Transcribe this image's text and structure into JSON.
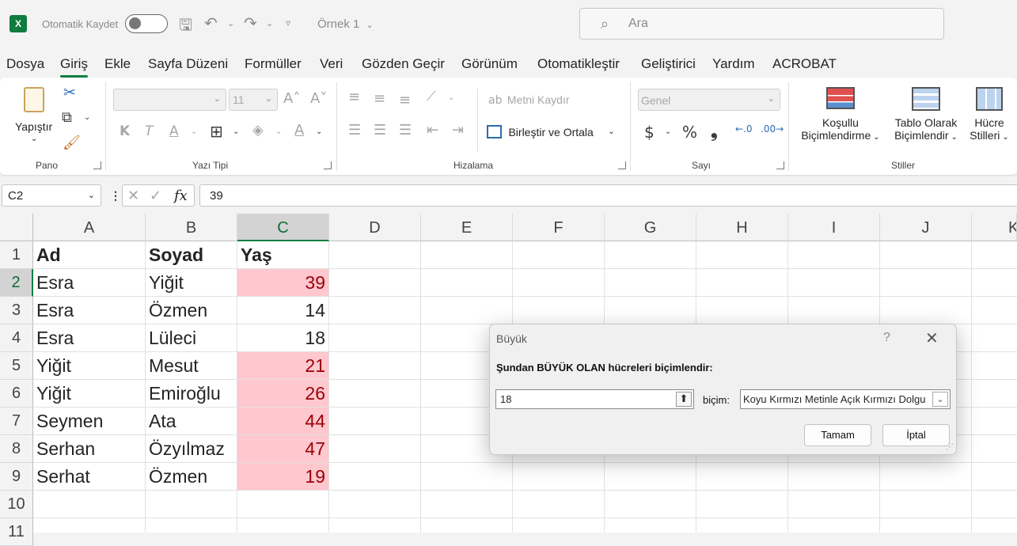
{
  "titlebar": {
    "autosave_label": "Otomatik Kaydet",
    "filename": "Örnek 1",
    "search_placeholder": "Ara"
  },
  "menu": [
    "Dosya",
    "Giriş",
    "Ekle",
    "Sayfa Düzeni",
    "Formüller",
    "Veri",
    "Gözden Geçir",
    "Görünüm",
    "Otomatikleştir",
    "Geliştirici",
    "Yardım",
    "ACROBAT"
  ],
  "menu_active": "Giriş",
  "ribbon": {
    "pano": {
      "label": "Pano",
      "paste": "Yapıştır"
    },
    "yazi_tipi": {
      "label": "Yazı Tipi",
      "font_size": "11",
      "bold": "K",
      "italic": "T",
      "underline": "A"
    },
    "hizalama": {
      "label": "Hizalama",
      "wrap": "Metni Kaydır",
      "merge": "Birleştir ve Ortala"
    },
    "sayi": {
      "label": "Sayı",
      "format": "Genel",
      "currency": "$",
      "percent": "%",
      "comma": "❟"
    },
    "stiller": {
      "label": "Stiller",
      "cond_l1": "Koşullu",
      "cond_l2": "Biçimlendirme",
      "table_l1": "Tablo Olarak",
      "table_l2": "Biçimlendir",
      "cell_l1": "Hücre",
      "cell_l2": "Stilleri"
    }
  },
  "formula_bar": {
    "name_box": "C2",
    "formula": "39"
  },
  "columns": [
    "A",
    "B",
    "C",
    "D",
    "E",
    "F",
    "G",
    "H",
    "I",
    "J",
    "K"
  ],
  "rows": [
    "1",
    "2",
    "3",
    "4",
    "5",
    "6",
    "7",
    "8",
    "9",
    "10",
    "11"
  ],
  "table": {
    "headers": [
      "Ad",
      "Soyad",
      "Yaş"
    ],
    "data": [
      [
        "Esra",
        "Yiğit",
        "39"
      ],
      [
        "Esra",
        "Özmen",
        "14"
      ],
      [
        "Esra",
        "Lüleci",
        "18"
      ],
      [
        "Yiğit",
        "Mesut",
        "21"
      ],
      [
        "Yiğit",
        "Emiroğlu",
        "26"
      ],
      [
        "Seymen",
        "Ata",
        "44"
      ],
      [
        "Serhan",
        "Özyılmaz",
        "47"
      ],
      [
        "Serhat",
        "Özmen",
        "19"
      ]
    ]
  },
  "dialog": {
    "title": "Büyük",
    "help": "?",
    "prompt": "Şundan BÜYÜK OLAN hücreleri biçimlendir:",
    "value": "18",
    "format_label": "biçim:",
    "format_value": "Koyu Kırmızı Metinle Açık Kırmızı Dolgu",
    "ok": "Tamam",
    "cancel": "İptal"
  },
  "colors": {
    "accent": "#117e3f",
    "highlight_fill": "#ffc7ce",
    "highlight_text": "#9c0006"
  }
}
